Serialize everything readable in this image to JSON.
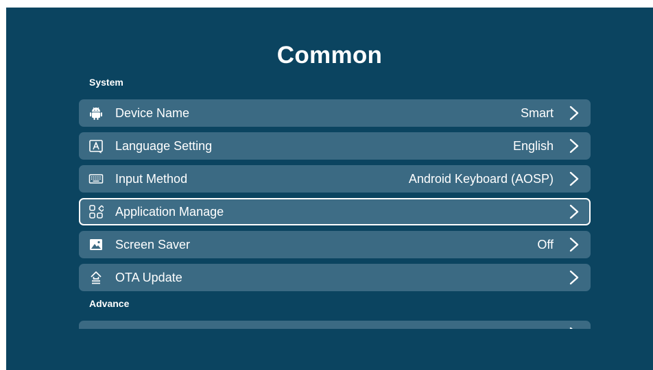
{
  "page": {
    "title": "Common"
  },
  "sections": {
    "system": "System",
    "advance": "Advance"
  },
  "system_items": [
    {
      "label": "Device Name",
      "value": "Smart",
      "icon": "android-icon"
    },
    {
      "label": "Language Setting",
      "value": "English",
      "icon": "language-icon"
    },
    {
      "label": "Input Method",
      "value": "Android Keyboard (AOSP)",
      "icon": "keyboard-icon"
    },
    {
      "label": "Application Manage",
      "value": "",
      "icon": "apps-grid-icon",
      "focused": true
    },
    {
      "label": "Screen Saver",
      "value": "Off",
      "icon": "image-icon"
    },
    {
      "label": "OTA Update",
      "value": "",
      "icon": "ota-update-icon"
    }
  ],
  "colors": {
    "background": "#0b4460",
    "row": "#3b6a83",
    "text": "#ffffff",
    "focus_border": "#ffffff"
  }
}
